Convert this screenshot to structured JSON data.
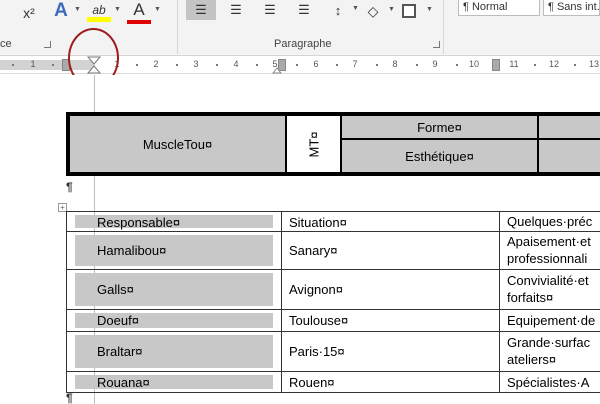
{
  "ribbon": {
    "font_group_label_fragment": "ce",
    "superscript_label": "x²",
    "text_effects_label": "A",
    "highlight_label": "ab",
    "font_color_label": "A",
    "highlight_color": "#ffff00",
    "font_color": "#e00000",
    "paragraph_group_label": "Paragraphe",
    "styles": [
      "¶ Normal",
      "¶ Sans int."
    ]
  },
  "ruler": {
    "numbers": [
      "1",
      "1",
      "2",
      "3",
      "4",
      "5",
      "6",
      "7",
      "8",
      "9",
      "10",
      "11",
      "12",
      "13"
    ]
  },
  "header_table": {
    "company": "MuscleTou¤",
    "vertical_cell": "MT¤",
    "row1_label": "Forme¤",
    "row2_label": "Esthétique¤"
  },
  "data_table": {
    "rows": [
      {
        "responsable": "Responsable¤",
        "situation": "Situation¤",
        "details": [
          "Quelques·préc"
        ]
      },
      {
        "responsable": "Hamalibou¤",
        "situation": "Sanary¤",
        "details": [
          "Apaisement·et",
          "professionnali"
        ]
      },
      {
        "responsable": "Galls¤",
        "situation": "Avignon¤",
        "details": [
          "Convivialité·et",
          "forfaits¤"
        ]
      },
      {
        "responsable": "Doeuf¤",
        "situation": "Toulouse¤",
        "details": [
          "Equipement·de"
        ]
      },
      {
        "responsable": "Braltar¤",
        "situation": "Paris·15¤",
        "details": [
          "Grande·surfac",
          "ateliers¤"
        ]
      },
      {
        "responsable": "Rouana¤",
        "situation": "Rouen¤",
        "details": [
          "Spécialistes·A"
        ]
      }
    ]
  },
  "marks": {
    "pilcrow": "¶",
    "table_move_handle": "+"
  }
}
